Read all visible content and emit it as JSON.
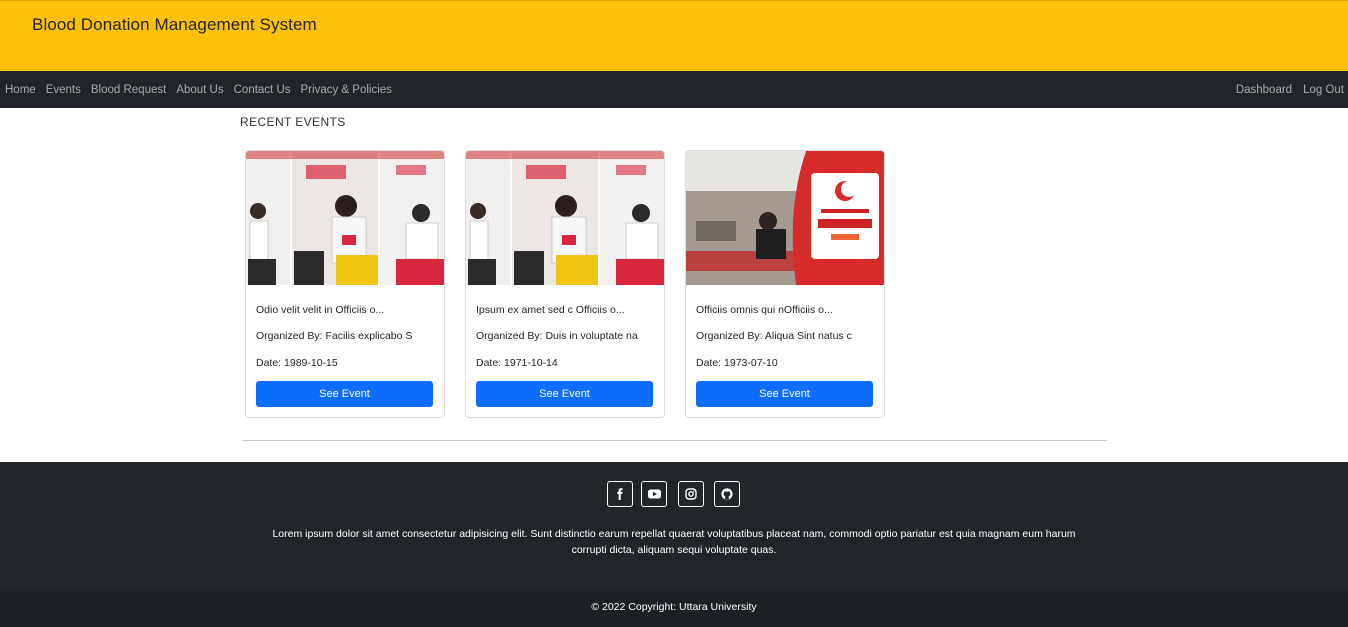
{
  "header": {
    "brand": "Blood Donation Management System"
  },
  "nav": {
    "left": [
      "Home",
      "Events",
      "Blood Request",
      "About Us",
      "Contact Us",
      "Privacy & Policies"
    ],
    "right": [
      "Dashboard",
      "Log Out"
    ]
  },
  "events": {
    "section_title": "RECENT EVENTS",
    "cards": [
      {
        "title": "Odio velit velit in Officiis o...",
        "organizer": "Organized By: Facilis explicabo S",
        "date": "Date: 1989-10-15",
        "button": "See Event",
        "image": "blood-donation-photo"
      },
      {
        "title": "Ipsum ex amet sed c Officiis o...",
        "organizer": "Organized By: Duis in voluptate na",
        "date": "Date: 1971-10-14",
        "button": "See Event",
        "image": "blood-donation-photo"
      },
      {
        "title": "Officiis omnis qui nOfficiis o...",
        "organizer": "Organized By: Aliqua Sint natus c",
        "date": "Date: 1973-07-10",
        "button": "See Event",
        "image": "kizilay-donation-photo"
      }
    ]
  },
  "footer": {
    "social": [
      "facebook-icon",
      "youtube-icon",
      "instagram-icon",
      "github-icon"
    ],
    "text": "Lorem ipsum dolor sit amet consectetur adipisicing elit. Sunt distinctio earum repellat quaerat voluptatibus placeat nam, commodi optio pariatur est quia magnam eum harum corrupti dicta, aliquam sequi voluptate quas.",
    "copyright": "© 2022 Copyright: Uttara University"
  },
  "colors": {
    "header_bg": "#ffc107",
    "nav_bg": "#212529",
    "button": "#0d6efd",
    "footer_bg": "#212529",
    "copyright_bg": "#1c1f23"
  }
}
